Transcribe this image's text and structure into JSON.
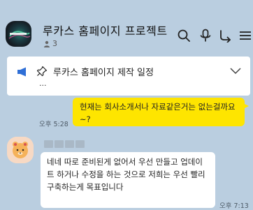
{
  "header": {
    "title": "루카스 홈페이지 프로젝트",
    "member_count": "3",
    "icons": [
      "search-icon",
      "microphone-icon",
      "call-icon",
      "menu-icon"
    ]
  },
  "notice": {
    "title": "루카스 홈페이지 제작 일정",
    "more": "...",
    "icons": [
      "megaphone-icon",
      "pin-icon",
      "chevron-down-icon"
    ]
  },
  "messages": [
    {
      "sender": "me",
      "text": "현재는 회사소개서나 자료같은거는 없는걸까요~?",
      "time": "오후 5:28",
      "bubble_color": "#fee500"
    },
    {
      "sender": "friend",
      "text": "네네 따로 준비된게 없어서 우선 만들고 업데이트 하거나 수정을 하는 것으로 저희는 우선 빨리 구축하는게 목표입니다",
      "time": "오후 7:13",
      "bubble_color": "#ffffff"
    }
  ],
  "colors": {
    "background": "#bacee0",
    "my_bubble": "#fee500",
    "friend_bubble": "#ffffff",
    "notice_icon": "#2f6fd6"
  }
}
